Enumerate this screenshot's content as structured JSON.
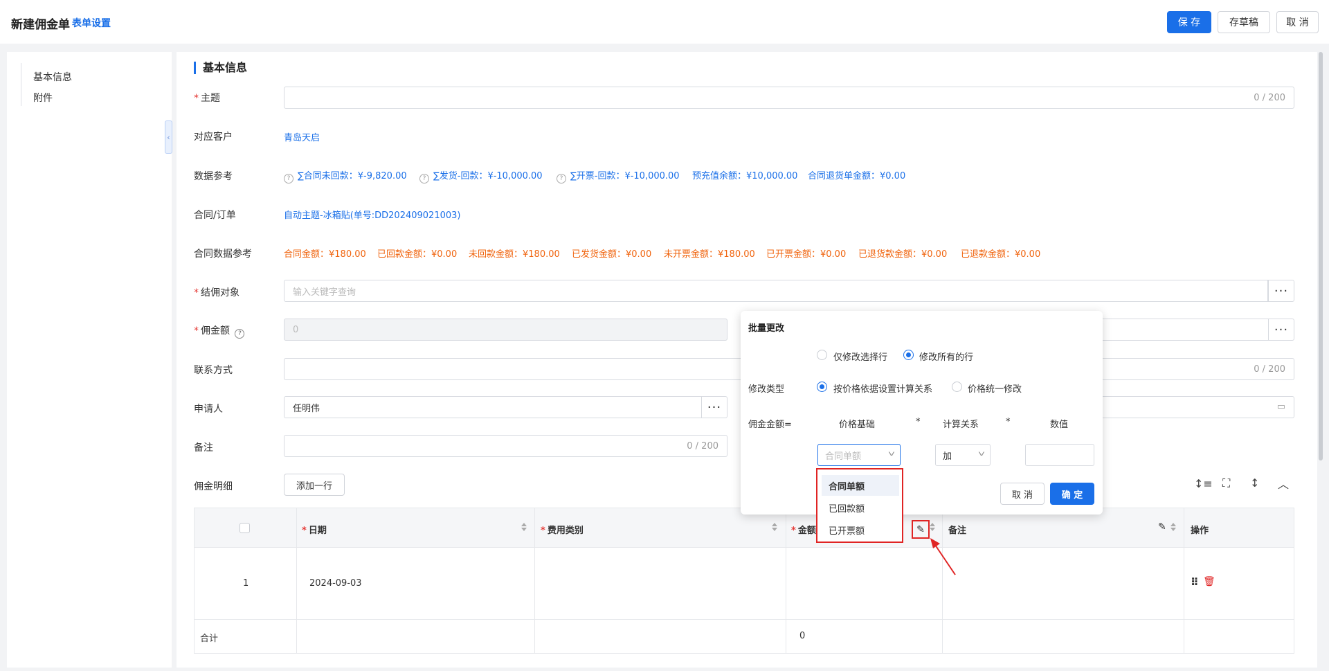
{
  "header": {
    "title": "新建佣金单",
    "form_settings": "表单设置",
    "save": "保 存",
    "draft": "存草稿",
    "cancel": "取 消"
  },
  "nav": {
    "items": [
      "基本信息",
      "附件"
    ]
  },
  "section": {
    "title": "基本信息"
  },
  "form": {
    "subject": {
      "label": "主题",
      "counter": "0 / 200"
    },
    "customer": {
      "label": "对应客户",
      "value": "青岛天启"
    },
    "data_ref": {
      "label": "数据参考",
      "items": [
        "∑合同未回款：¥-9,820.00",
        "∑发货-回款：¥-10,000.00",
        "∑开票-回款：¥-10,000.00",
        "预充值余额：¥10,000.00",
        "合同退货单金额：¥0.00"
      ]
    },
    "contract": {
      "label": "合同/订单",
      "value": "自动主题-冰箱贴(单号:DD202409021003)"
    },
    "contract_data": {
      "label": "合同数据参考",
      "items": [
        "合同金额：¥180.00",
        "已回款金额：¥0.00",
        "未回款金额：¥180.00",
        "已发货金额：¥0.00",
        "未开票金额：¥180.00",
        "已开票金额：¥0.00",
        "已退货款金额：¥0.00",
        "已退款金额：¥0.00"
      ]
    },
    "target": {
      "label": "结佣对象",
      "placeholder": "输入关键字查询"
    },
    "amount": {
      "label": "佣金额",
      "value": "0"
    },
    "contact": {
      "label": "联系方式",
      "counter": "0 / 200"
    },
    "applicant": {
      "label": "申请人",
      "value": "任明伟"
    },
    "remark": {
      "label": "备注",
      "counter": "0 / 200"
    },
    "detail": {
      "label": "佣金明细",
      "add_row": "添加一行"
    }
  },
  "table": {
    "columns": {
      "date": "日期",
      "fee_type": "费用类别",
      "amount": "金额",
      "remark": "备注",
      "ops": "操作"
    },
    "rows": [
      {
        "index": "1",
        "date": "2024-09-03"
      }
    ],
    "total_label": "合计",
    "total_amount": "0"
  },
  "popover": {
    "title": "批量更改",
    "scope_selected": "仅修改选择行",
    "scope_all": "修改所有的行",
    "type_label": "修改类型",
    "type_calc": "按价格依据设置计算关系",
    "type_uniform": "价格统一修改",
    "formula_label": "佣金金额=",
    "col_base": "价格基础",
    "col_relation": "计算关系",
    "col_value": "数值",
    "star": "*",
    "base_placeholder": "合同单额",
    "relation_value": "加",
    "cancel": "取 消",
    "confirm": "确 定",
    "options": [
      "合同单额",
      "已回款额",
      "已开票额"
    ]
  },
  "colors": {
    "primary": "#1a6fe8",
    "orange": "#f0640e",
    "danger": "#e02424"
  }
}
